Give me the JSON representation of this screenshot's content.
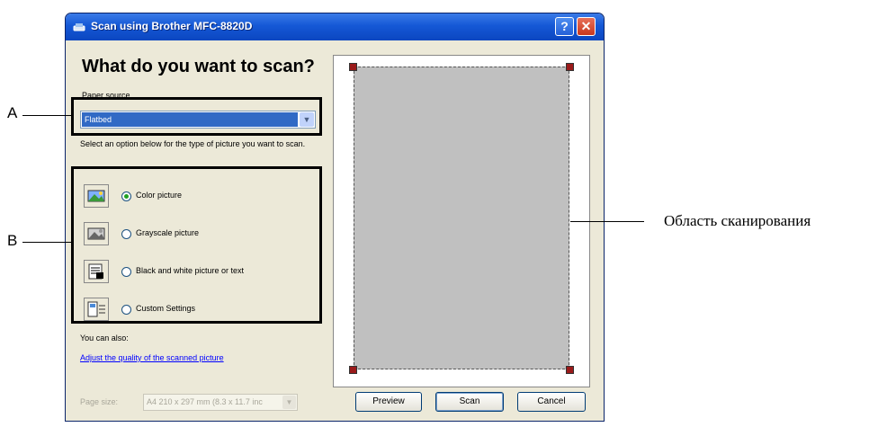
{
  "window": {
    "title": "Scan using Brother MFC-8820D",
    "help_glyph": "?",
    "close_glyph": "✕"
  },
  "main": {
    "heading": "What do you want to scan?",
    "paper_source_label": "Paper source",
    "paper_source_value": "Flatbed",
    "instruction": "Select an option below for the type of picture you want to scan.",
    "options": [
      {
        "label": "Color picture",
        "checked": true,
        "icon": "color-picture-icon"
      },
      {
        "label": "Grayscale picture",
        "checked": false,
        "icon": "grayscale-picture-icon"
      },
      {
        "label": "Black and white picture or text",
        "checked": false,
        "icon": "black-white-text-icon"
      },
      {
        "label": "Custom Settings",
        "checked": false,
        "icon": "custom-settings-icon"
      }
    ],
    "also_label": "You can also:",
    "adjust_link": "Adjust the quality of the scanned picture",
    "page_size_label": "Page size:",
    "page_size_value": "A4 210 x 297 mm (8.3 x 11.7 inc"
  },
  "buttons": {
    "preview": "Preview",
    "scan": "Scan",
    "cancel": "Cancel"
  },
  "annotations": {
    "a": "A",
    "b": "B",
    "scan_area": "Область сканирования"
  },
  "colors": {
    "title_bar": "#0b46c0",
    "selection": "#316ac5",
    "scan_area": "#c0c0c0",
    "radio_selected": "#21a121"
  }
}
